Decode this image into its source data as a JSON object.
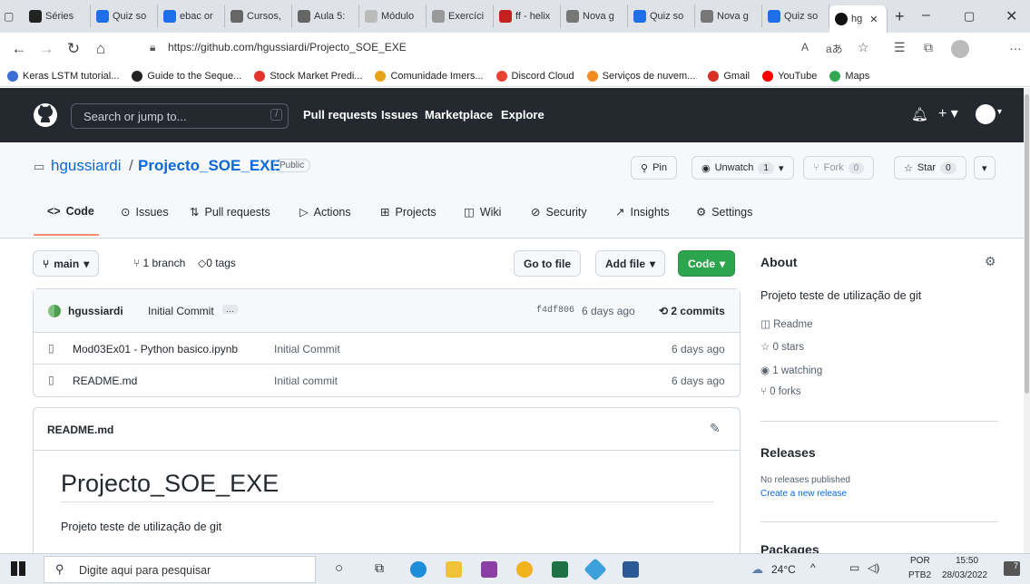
{
  "browser": {
    "tabs": [
      {
        "label": "Séries",
        "color": "#222"
      },
      {
        "label": "Quiz so",
        "color": "#1f6feb"
      },
      {
        "label": "ebac or",
        "color": "#1f6feb"
      },
      {
        "label": "Cursos,",
        "color": "#666"
      },
      {
        "label": "Aula 5:",
        "color": "#666"
      },
      {
        "label": "Módulo",
        "color": "#bbb"
      },
      {
        "label": "Exercíci",
        "color": "#999"
      },
      {
        "label": "ff - helix",
        "color": "#c5221f"
      },
      {
        "label": "Nova g",
        "color": "#777"
      },
      {
        "label": "Quiz so",
        "color": "#1f6feb"
      },
      {
        "label": "Nova g",
        "color": "#777"
      },
      {
        "label": "Quiz so",
        "color": "#1f6feb"
      }
    ],
    "active_tab": "hg",
    "url": "https://github.com/hgussiardi/Projecto_SOE_EXE",
    "bookmarks": [
      {
        "label": "Keras LSTM tutorial...",
        "color": "#3b6ed8"
      },
      {
        "label": "Guide to the Seque...",
        "color": "#222"
      },
      {
        "label": "Stock Market Predi...",
        "color": "#e3342f"
      },
      {
        "label": "Comunidade Imers...",
        "color": "#e8a317"
      },
      {
        "label": "Discord Cloud",
        "color": "#e94235"
      },
      {
        "label": "Serviços de nuvem...",
        "color": "#f28b22"
      },
      {
        "label": "Gmail",
        "color": "#d93025"
      },
      {
        "label": "YouTube",
        "color": "#ff0000"
      },
      {
        "label": "Maps",
        "color": "#34a853"
      }
    ]
  },
  "github": {
    "search_placeholder": "Search or jump to...",
    "nav": [
      "Pull requests",
      "Issues",
      "Marketplace",
      "Explore"
    ]
  },
  "repo": {
    "owner": "hgussiardi",
    "name": "Projecto_SOE_EXE",
    "visibility": "Public",
    "pin_label": "Pin",
    "unwatch_label": "Unwatch",
    "unwatch_count": "1",
    "fork_label": "Fork",
    "fork_count": "0",
    "star_label": "Star",
    "star_count": "0",
    "tabs": [
      "Code",
      "Issues",
      "Pull requests",
      "Actions",
      "Projects",
      "Wiki",
      "Security",
      "Insights",
      "Settings"
    ]
  },
  "toolbar": {
    "branch": "main",
    "branches": "1 branch",
    "tags": "0 tags",
    "goto_file": "Go to file",
    "add_file": "Add file",
    "code": "Code"
  },
  "commit": {
    "author": "hgussiardi",
    "message": "Initial Commit",
    "hash": "f4df806",
    "time": "6 days ago",
    "commits": "2 commits"
  },
  "files": [
    {
      "name": "Mod03Ex01 - Python basico.ipynb",
      "message": "Initial Commit",
      "time": "6 days ago"
    },
    {
      "name": "README.md",
      "message": "Initial commit",
      "time": "6 days ago"
    }
  ],
  "readme": {
    "filename": "README.md",
    "heading": "Projecto_SOE_EXE",
    "text": "Projeto teste de utilização de git"
  },
  "about": {
    "title": "About",
    "description": "Projeto teste de utilização de git",
    "readme": "Readme",
    "stars": "0 stars",
    "watching": "1 watching",
    "forks": "0 forks",
    "releases_title": "Releases",
    "no_releases": "No releases published",
    "create_release": "Create a new release",
    "packages_title": "Packages"
  },
  "taskbar": {
    "search": "Digite aqui para pesquisar",
    "weather": "24°C",
    "lang1": "POR",
    "lang2": "PTB2",
    "time": "15:50",
    "date": "28/03/2022",
    "notif": "7"
  }
}
